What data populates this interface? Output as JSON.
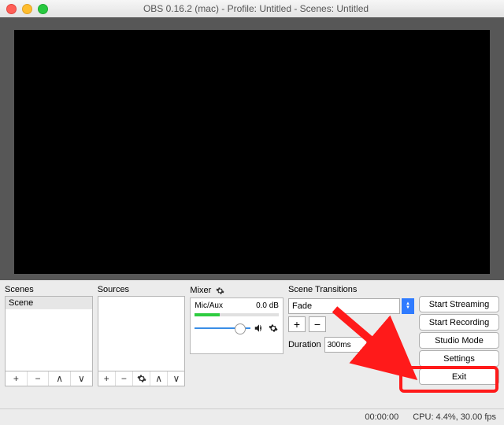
{
  "title": "OBS 0.16.2 (mac) - Profile: Untitled - Scenes: Untitled",
  "scenes": {
    "label": "Scenes",
    "items": [
      "Scene"
    ]
  },
  "sources": {
    "label": "Sources",
    "items": []
  },
  "mixer": {
    "label": "Mixer",
    "channel": {
      "name": "Mic/Aux",
      "level": "0.0 dB"
    }
  },
  "transitions": {
    "label": "Scene Transitions",
    "selected": "Fade",
    "duration_label": "Duration",
    "duration_value": "300ms"
  },
  "buttons": {
    "start_streaming": "Start Streaming",
    "start_recording": "Start Recording",
    "studio_mode": "Studio Mode",
    "settings": "Settings",
    "exit": "Exit"
  },
  "ctrl": {
    "plus": "+",
    "minus": "−",
    "up": "∧",
    "down": "∨"
  },
  "status": {
    "time": "00:00:00",
    "cpu": "CPU: 4.4%, 30.00 fps"
  }
}
